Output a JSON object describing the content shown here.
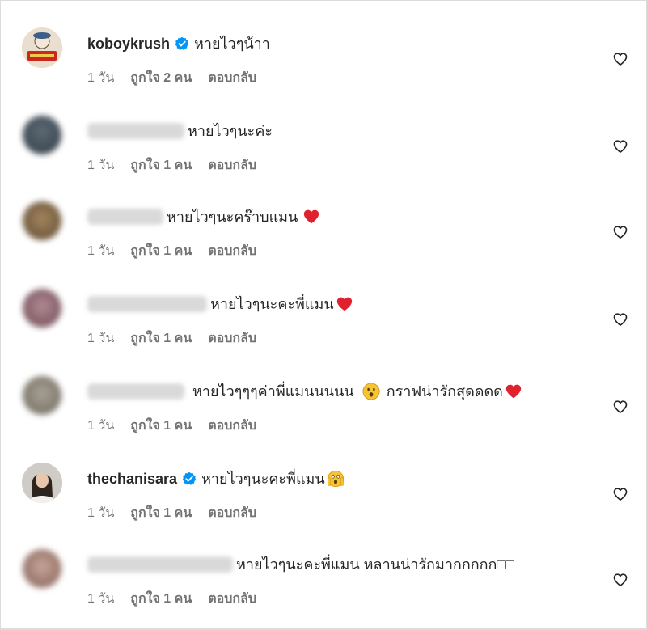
{
  "comments": [
    {
      "username": "koboykrush",
      "verified": true,
      "text": "หายไวๆน้าา",
      "time": "1 วัน",
      "likes": "ถูกใจ 2 คน",
      "reply": "ตอบกลับ",
      "avatar_color": "#e8d9c3",
      "emoji": ""
    },
    {
      "username": "",
      "verified": false,
      "text": "หายไวๆนะค่ะ",
      "time": "1 วัน",
      "likes": "ถูกใจ 1 คน",
      "reply": "ตอบกลับ",
      "avatar_color": "#3d4a55",
      "emoji": ""
    },
    {
      "username": "",
      "verified": false,
      "text": "หายไวๆนะคร๊าบแมน",
      "time": "1 วัน",
      "likes": "ถูกใจ 1 คน",
      "reply": "ตอบกลับ",
      "avatar_color": "#8a6a44",
      "emoji": "heart"
    },
    {
      "username": "",
      "verified": false,
      "text": "หายไวๆนะคะพี่แมน",
      "time": "1 วัน",
      "likes": "ถูกใจ 1 คน",
      "reply": "ตอบกลับ",
      "avatar_color": "#9a6f78",
      "emoji": "heart"
    },
    {
      "username": "",
      "verified": false,
      "text": "หายไวๆๆๆค่าพี่แมนนนนน",
      "text2": "กราฟน่ารักสุดดดด",
      "time": "1 วัน",
      "likes": "ถูกใจ 1 คน",
      "reply": "ตอบกลับ",
      "avatar_color": "#8b8478",
      "emoji": "surprised"
    },
    {
      "username": "thechanisara",
      "verified": true,
      "text": "หายไวๆนะคะพี่แมน",
      "time": "1 วัน",
      "likes": "ถูกใจ 1 คน",
      "reply": "ตอบกลับ",
      "avatar_color": "#d7d2cc",
      "emoji": "scream"
    },
    {
      "username": "",
      "verified": false,
      "text": "หายไวๆนะคะพี่แมน หลานน่ารักมากกกกก□□",
      "time": "1 วัน",
      "likes": "ถูกใจ 1 คน",
      "reply": "ตอบกลับ",
      "avatar_color": "#b48c80",
      "emoji": ""
    }
  ],
  "colors": {
    "text": "#262626",
    "meta": "#737373",
    "verified": "#0095f6",
    "heart_emoji": "#e0212e"
  }
}
